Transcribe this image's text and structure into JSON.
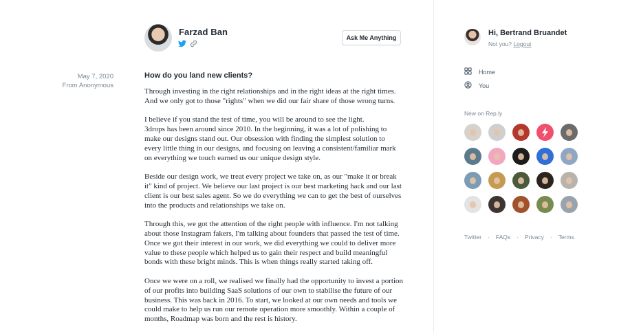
{
  "post": {
    "author_name": "Farzad Ban",
    "ask_button": "Ask Me Anything",
    "date": "May 7, 2020",
    "from": "From Anonymous",
    "question": "How do you land new clients?",
    "paragraphs": [
      "Through investing in the right relationships and in the right ideas at the right times.\nAnd we only got to those \"rights\" when we did our fair share of those wrong turns.",
      "I believe if you stand the test of time, you will be around to see the light.\n3drops has been around since 2010. In the beginning, it was a lot of polishing to\nmake our designs stand out. Our obsession with finding the simplest solution to\nevery little thing in our designs, and focusing on leaving a consistent/familiar mark\non everything we touch earned us our unique design style.",
      "Beside our design work, we treat every project we take on, as our \"make it or break\nit\" kind of project. We believe our last project is our best marketing hack and our last\nclient is our best sales agent. So we do everything we can to get the best of ourselves\ninto the products and relationships we take on.",
      "Through this, we got the attention of the right people with influence. I'm not talking\nabout those Instagram fakers, I'm talking about founders that passed the test of time.\nOnce we got their interest in our work, we did everything we could to deliver more\nvalue to these people which helped us to gain their respect and build meaningful\nbonds with these bright minds. This is when things really started taking off.",
      "Once we were on a roll, we realised we finally had the opportunity to invest a portion\nof our profits into building SaaS solutions of our own to stabilise the future of our\nbusiness. This was back in 2016. To start, we looked at our own needs and tools we\ncould make to help us run our remote operation more smoothly. Within a couple of\nmonths, Roadmap was born and the rest is history."
    ]
  },
  "sidebar": {
    "greeting": "Hi, Bertrand Bruandet",
    "not_you": "Not you?",
    "logout": "Logout",
    "nav_home": "Home",
    "nav_you": "You",
    "new_title": "New on Rep.ly",
    "footer": [
      "Twitter",
      "FAQs",
      "Privacy",
      "Terms"
    ],
    "footer_sep": "·"
  },
  "icons": {
    "twitter": "twitter-icon",
    "link": "link-icon",
    "home": "grid-icon",
    "you": "user-circle-icon"
  },
  "colors": {
    "twitter": "#1da1f2",
    "accent_logo": "#f0506e"
  }
}
